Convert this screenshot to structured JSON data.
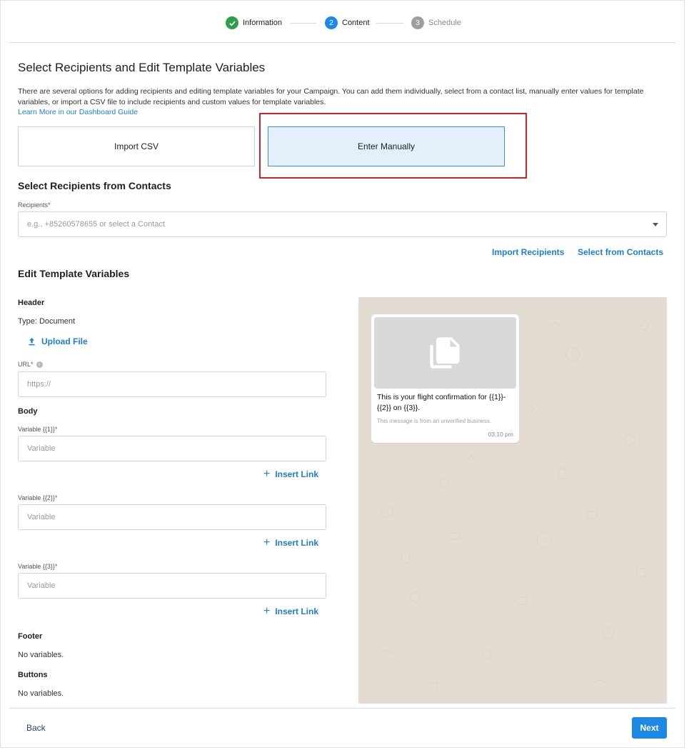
{
  "stepper": {
    "steps": [
      {
        "number": "",
        "label": "Information",
        "status": "complete",
        "color": "#2e9e4a"
      },
      {
        "number": "2",
        "label": "Content",
        "status": "active",
        "color": "#1e88e5"
      },
      {
        "number": "3",
        "label": "Schedule",
        "status": "pending",
        "color": "#9e9e9e"
      }
    ]
  },
  "page": {
    "title": "Select Recipients and Edit Template Variables",
    "description": "There are several options for adding recipients and editing template variables for your Campaign. You can add them individually, select from a contact list, manually enter values for template variables, or import a CSV file to include recipients and custom values for template variables.",
    "guide_link": "Learn More in our Dashboard Guide"
  },
  "options": {
    "import_csv": "Import CSV",
    "enter_manually": "Enter Manually",
    "selected": "enter_manually"
  },
  "recipients_section": {
    "title": "Select Recipients from Contacts",
    "label": "Recipients",
    "required_mark": "*",
    "placeholder": "e.g., +85260578655 or select a Contact",
    "import_recipients": "Import Recipients",
    "select_from_contacts": "Select from Contacts"
  },
  "template_section": {
    "title": "Edit Template Variables",
    "header": {
      "heading": "Header",
      "type_text": "Type: Document",
      "upload_label": "Upload File",
      "url_label": "URL",
      "url_required": "*",
      "url_placeholder": "https://"
    },
    "body": {
      "heading": "Body",
      "variables": [
        {
          "label": "Variable {{1}}",
          "required": "*",
          "placeholder": "Variable",
          "insert_link": "Insert Link"
        },
        {
          "label": "Variable {{2}}",
          "required": "*",
          "placeholder": "Variable",
          "insert_link": "Insert Link"
        },
        {
          "label": "Variable {{3}}",
          "required": "*",
          "placeholder": "Variable",
          "insert_link": "Insert Link"
        }
      ]
    },
    "footer": {
      "heading": "Footer",
      "text": "No variables."
    },
    "buttons": {
      "heading": "Buttons",
      "text": "No variables."
    }
  },
  "preview": {
    "message_line1": "This is your flight confirmation for {{1}}-",
    "message_line2": "{{2}} on {{3}}.",
    "note": "This message is from an unverified business.",
    "time": "03:10 pm",
    "background_color": "#e4dcd3"
  },
  "footer_nav": {
    "back": "Back",
    "next": "Next"
  },
  "colors": {
    "accent": "#1e88e5",
    "link": "#1a7ed8",
    "highlight_border": "#cc2229"
  }
}
